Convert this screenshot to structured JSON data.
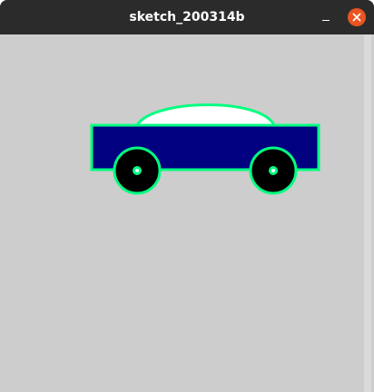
{
  "window": {
    "title": "sketch_200314b",
    "controls": {
      "minimize_icon": "minimize-icon",
      "close_icon": "close-icon"
    }
  },
  "colors": {
    "titlebar": "#2b2b2b",
    "title_text": "#ffffff",
    "close_button": "#e95420",
    "canvas_background": "#cdcdcd",
    "right_strip": "#dadada",
    "car_body_fill": "#000080",
    "car_outline": "#00ff80",
    "car_roof_fill": "#ffffff",
    "wheel_fill": "#000000",
    "hub_fill": "#00ff80",
    "hub_center": "#ffffff"
  },
  "sketch": {
    "shapes": [
      "car-body",
      "car-roof",
      "front-wheel",
      "rear-wheel"
    ]
  }
}
